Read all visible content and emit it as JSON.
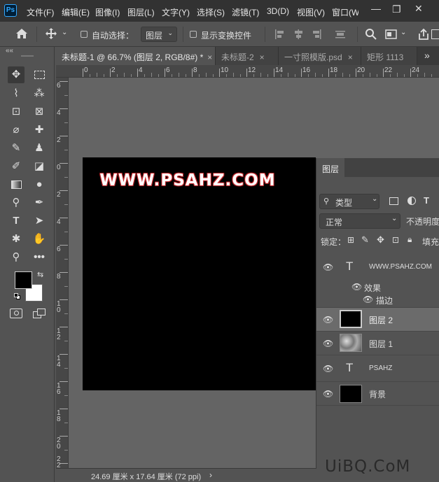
{
  "app": {
    "logo": "Ps"
  },
  "menu": [
    "文件(F)",
    "编辑(E)",
    "图像(I)",
    "图层(L)",
    "文字(Y)",
    "选择(S)",
    "滤镜(T)",
    "3D(D)",
    "视图(V)",
    "窗口(W"
  ],
  "window_controls": {
    "minimize": "—",
    "restore": "❐",
    "close": "✕"
  },
  "options": {
    "auto_select_label": "自动选择：",
    "auto_select_value": "图层",
    "show_transform_label": "显示变换控件"
  },
  "tabs": [
    {
      "label": "未标题-1 @ 66.7% (图层 2, RGB/8#) *",
      "close": "×"
    },
    {
      "label": "未标题-2",
      "close": "×"
    },
    {
      "label": "一寸照模版.psd",
      "close": "×"
    },
    {
      "label": "矩形 1113",
      "close": ""
    }
  ],
  "tabs_overflow": "»",
  "toolbar_collapse": "««",
  "ruler_top": [
    "0",
    "2",
    "4",
    "6",
    "8",
    "10",
    "12",
    "14",
    "16",
    "18",
    "20",
    "22",
    "24"
  ],
  "ruler_left": [
    "6",
    "4",
    "2",
    "0",
    "2",
    "4",
    "6",
    "8",
    "10",
    "12",
    "14",
    "16",
    "18",
    "20",
    "22"
  ],
  "canvas": {
    "text": "WWW.PSAHZ.COM",
    "bg": "#000000",
    "text_color": "#ffffff",
    "stroke_color": "#c0262a"
  },
  "status": {
    "doc_size": "24.69 厘米 x 17.64 厘米 (72 ppi)",
    "arrow": "›"
  },
  "layers_panel": {
    "title": "图层",
    "kind_label": "类型",
    "blend_mode": "正常",
    "opacity_label": "不透明度",
    "lock_label": "锁定：",
    "fill_label": "填充",
    "effects_label": "效果",
    "stroke_label": "描边",
    "layers": [
      {
        "name": "WWW.PSAHZ.COM",
        "type": "text",
        "glyph": "T"
      },
      {
        "name": "图层 2",
        "type": "pixel",
        "selected": true
      },
      {
        "name": "图层 1",
        "type": "texture"
      },
      {
        "name": "PSAHZ",
        "type": "text",
        "glyph": "T"
      },
      {
        "name": "背景",
        "type": "pixel"
      }
    ]
  },
  "watermark": "UiBQ.CoM"
}
